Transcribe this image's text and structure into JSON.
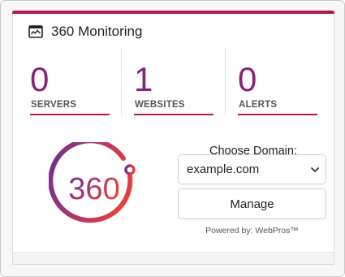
{
  "colors": {
    "accent": "#b5144e",
    "stat_number": "#8b2078",
    "stat_rule": "#b5164f",
    "logo_gradient_start": "#6b2f96",
    "logo_gradient_end": "#e63e3e"
  },
  "widget": {
    "title": "360 Monitoring",
    "title_icon": "monitor-icon"
  },
  "stats": [
    {
      "value": "0",
      "label": "SERVERS"
    },
    {
      "value": "1",
      "label": "WEBSITES"
    },
    {
      "value": "0",
      "label": "ALERTS"
    }
  ],
  "logo": {
    "text": "360"
  },
  "domain_picker": {
    "label": "Choose Domain:",
    "selected": "example.com",
    "chevron_icon": "chevron-down-icon"
  },
  "manage_button": {
    "label": "Manage"
  },
  "footer": {
    "powered_by": "Powered by: WebPros™"
  }
}
